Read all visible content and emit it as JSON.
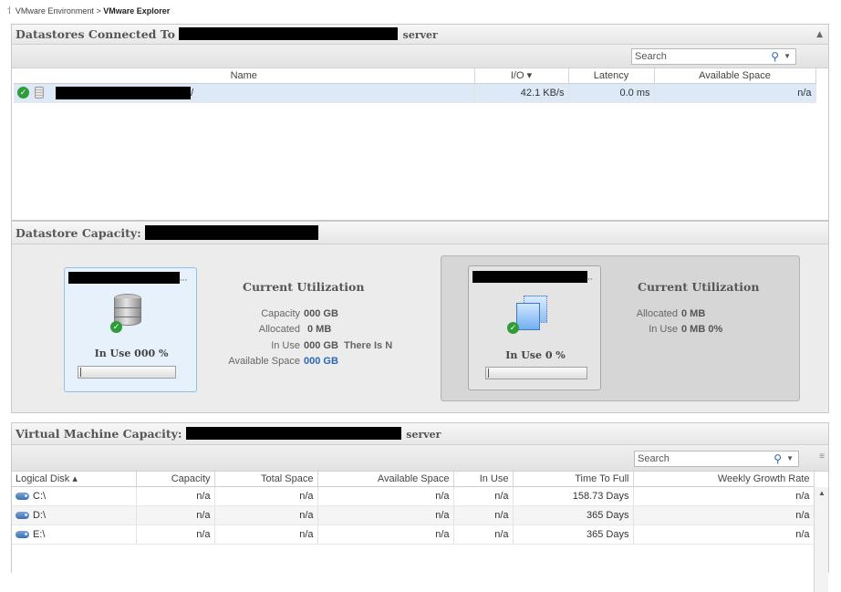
{
  "breadcrumb": {
    "icon": "tree-icon",
    "parent": "VMware Environment",
    "separator": ">",
    "current": "VMware Explorer"
  },
  "datastores_panel": {
    "title": "Datastores Connected To",
    "title_suffix": "server",
    "search_placeholder": "Search",
    "columns": {
      "name": "Name",
      "io": "I/O ▾",
      "latency": "Latency",
      "available": "Available Space"
    },
    "rows": [
      {
        "name_suffix": "/",
        "io": "42.1 KB/s",
        "latency": "0.0 ms",
        "available": "n/a",
        "status": "ok"
      }
    ]
  },
  "capacity_panel": {
    "title": "Datastore Capacity:",
    "left": {
      "title_ellipsis": "...",
      "in_use": "In Use 000 %",
      "in_use_percent": 0,
      "util_title": "Current Utilization",
      "capacity_label": "Capacity",
      "capacity_value": "000 GB",
      "allocated_label": "Allocated",
      "allocated_value": "0 MB",
      "inuse_label": "In Use",
      "inuse_value": "000 GB",
      "inuse_extra": "There Is N",
      "available_label": "Available Space",
      "available_value": "000 GB"
    },
    "right": {
      "title_ellipsis": "..",
      "in_use": "In Use 0 %",
      "in_use_percent": 0,
      "util_title": "Current Utilization",
      "allocated_label": "Allocated",
      "allocated_value": "0 MB",
      "inuse_label": "In Use",
      "inuse_value": "0 MB 0%"
    }
  },
  "vm_panel": {
    "title": "Virtual Machine Capacity:",
    "title_suffix": "server",
    "search_placeholder": "Search",
    "columns": {
      "disk": "Logical Disk ▴",
      "capacity": "Capacity",
      "total": "Total Space",
      "available": "Available Space",
      "inuse": "In Use",
      "ttf": "Time To Full",
      "growth": "Weekly Growth Rate"
    },
    "rows": [
      {
        "disk": "C:\\",
        "capacity": "n/a",
        "total": "n/a",
        "available": "n/a",
        "inuse": "n/a",
        "ttf": "158.73 Days",
        "growth": "n/a"
      },
      {
        "disk": "D:\\",
        "capacity": "n/a",
        "total": "n/a",
        "available": "n/a",
        "inuse": "n/a",
        "ttf": "365 Days",
        "growth": "n/a"
      },
      {
        "disk": "E:\\",
        "capacity": "n/a",
        "total": "n/a",
        "available": "n/a",
        "inuse": "n/a",
        "ttf": "365 Days",
        "growth": "n/a"
      }
    ]
  },
  "colors": {
    "accent_blue": "#2a67b8",
    "selected_row": "#dde9f7",
    "ok_green": "#2f9c3a",
    "left_card_border": "#8fbfe6",
    "left_card_bg": "#e6f1fb"
  }
}
